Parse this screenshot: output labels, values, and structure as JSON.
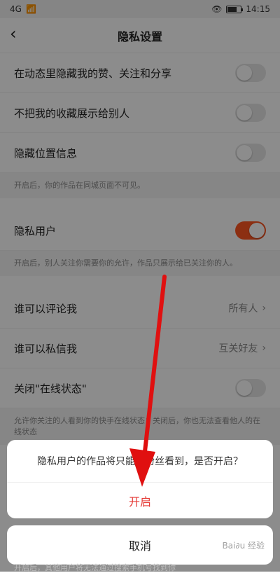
{
  "status": {
    "left_text": "4G",
    "time": "14:15",
    "battery_level": 0.7
  },
  "header": {
    "title": "隐私设置"
  },
  "rows": [
    {
      "label": "在动态里隐藏我的赞、关注和分享",
      "toggle": false
    },
    {
      "label": "不把我的收藏展示给别人",
      "toggle": false
    },
    {
      "label": "隐藏位置信息",
      "toggle": false
    }
  ],
  "notes": {
    "location": "开启后，你的作品在同城页面不可见。",
    "private_user": "开启后，别人关注你需要你的允许，作品只展示给已关注你的人。",
    "online": "允许你关注的人看到你的快手在线状态；关闭后，你也无法查看他人的在线状态"
  },
  "private_user": {
    "label": "隐私用户",
    "toggle": true
  },
  "comment": {
    "label": "谁可以评论我",
    "value": "所有人"
  },
  "message": {
    "label": "谁可以私信我",
    "value": "互关好友"
  },
  "online": {
    "label": "关闭\"在线状态\"",
    "toggle": false
  },
  "dialog": {
    "message": "隐私用户的作品将只能被粉丝看到，是否开启？",
    "confirm": "开启",
    "cancel": "取消"
  },
  "bottom_hint": "开启后，其他用户将无法通过搜索手机号找到你",
  "colors": {
    "accent": "#ff5722",
    "dialog_confirm": "#e53935"
  }
}
